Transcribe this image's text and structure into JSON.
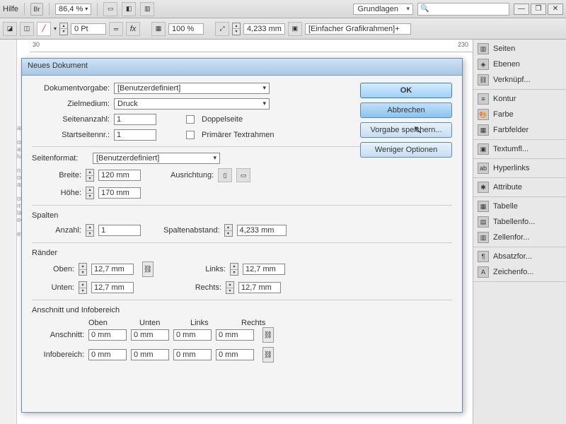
{
  "topbar": {
    "help": "Hilfe",
    "br": "Br",
    "zoom": "86,4 %",
    "workspace": "Grundlagen"
  },
  "toolbar": {
    "stroke": "0 Pt",
    "pct": "100 %",
    "meas": "4,233 mm",
    "frame": "[Einfacher Grafikrahmen]+"
  },
  "ruler": {
    "a": "30",
    "b": "230"
  },
  "panels": {
    "seiten": "Seiten",
    "ebenen": "Ebenen",
    "verkn": "Verknüpf...",
    "kontur": "Kontur",
    "farbe": "Farbe",
    "farbfelder": "Farbfelder",
    "textumfl": "Textumfl...",
    "hyperlinks": "Hyperlinks",
    "attribute": "Attribute",
    "tabelle": "Tabelle",
    "tabellenf": "Tabellenfo...",
    "zellenf": "Zellenfor...",
    "absatzf": "Absatzfor...",
    "zeichenf": "Zeichenfo..."
  },
  "dialog": {
    "title": "Neues Dokument",
    "preset_lbl": "Dokumentvorgabe:",
    "preset": "[Benutzerdefiniert]",
    "intent_lbl": "Zielmedium:",
    "intent": "Druck",
    "pages_lbl": "Seitenanzahl:",
    "pages": "1",
    "start_lbl": "Startseitennr.:",
    "start": "1",
    "facing": "Doppelseite",
    "primary": "Primärer Textrahmen",
    "sizefmt_lbl": "Seitenformat:",
    "sizefmt": "[Benutzerdefiniert]",
    "width_lbl": "Breite:",
    "width": "120 mm",
    "height_lbl": "Höhe:",
    "height": "170 mm",
    "orient_lbl": "Ausrichtung:",
    "cols": "Spalten",
    "cols_n_lbl": "Anzahl:",
    "cols_n": "1",
    "gutter_lbl": "Spaltenabstand:",
    "gutter": "4,233 mm",
    "margins": "Ränder",
    "top_lbl": "Oben:",
    "bottom_lbl": "Unten:",
    "left_lbl": "Links:",
    "right_lbl": "Rechts:",
    "m_top": "12,7 mm",
    "m_bottom": "12,7 mm",
    "m_left": "12,7 mm",
    "m_right": "12,7 mm",
    "bleed_sec": "Anschnitt und Infobereich",
    "bleed_lbl": "Anschnitt:",
    "slug_lbl": "Infobereich:",
    "hdr_top": "Oben",
    "hdr_bottom": "Unten",
    "hdr_left": "Links",
    "hdr_right": "Rechts",
    "b_t": "0 mm",
    "b_b": "0 mm",
    "b_l": "0 mm",
    "b_r": "0 mm",
    "s_t": "0 mm",
    "s_b": "0 mm",
    "s_l": "0 mm",
    "s_r": "0 mm",
    "ok": "OK",
    "cancel": "Abbrechen",
    "save": "Vorgabe speichern...",
    "fewer": "Weniger Optionen"
  }
}
